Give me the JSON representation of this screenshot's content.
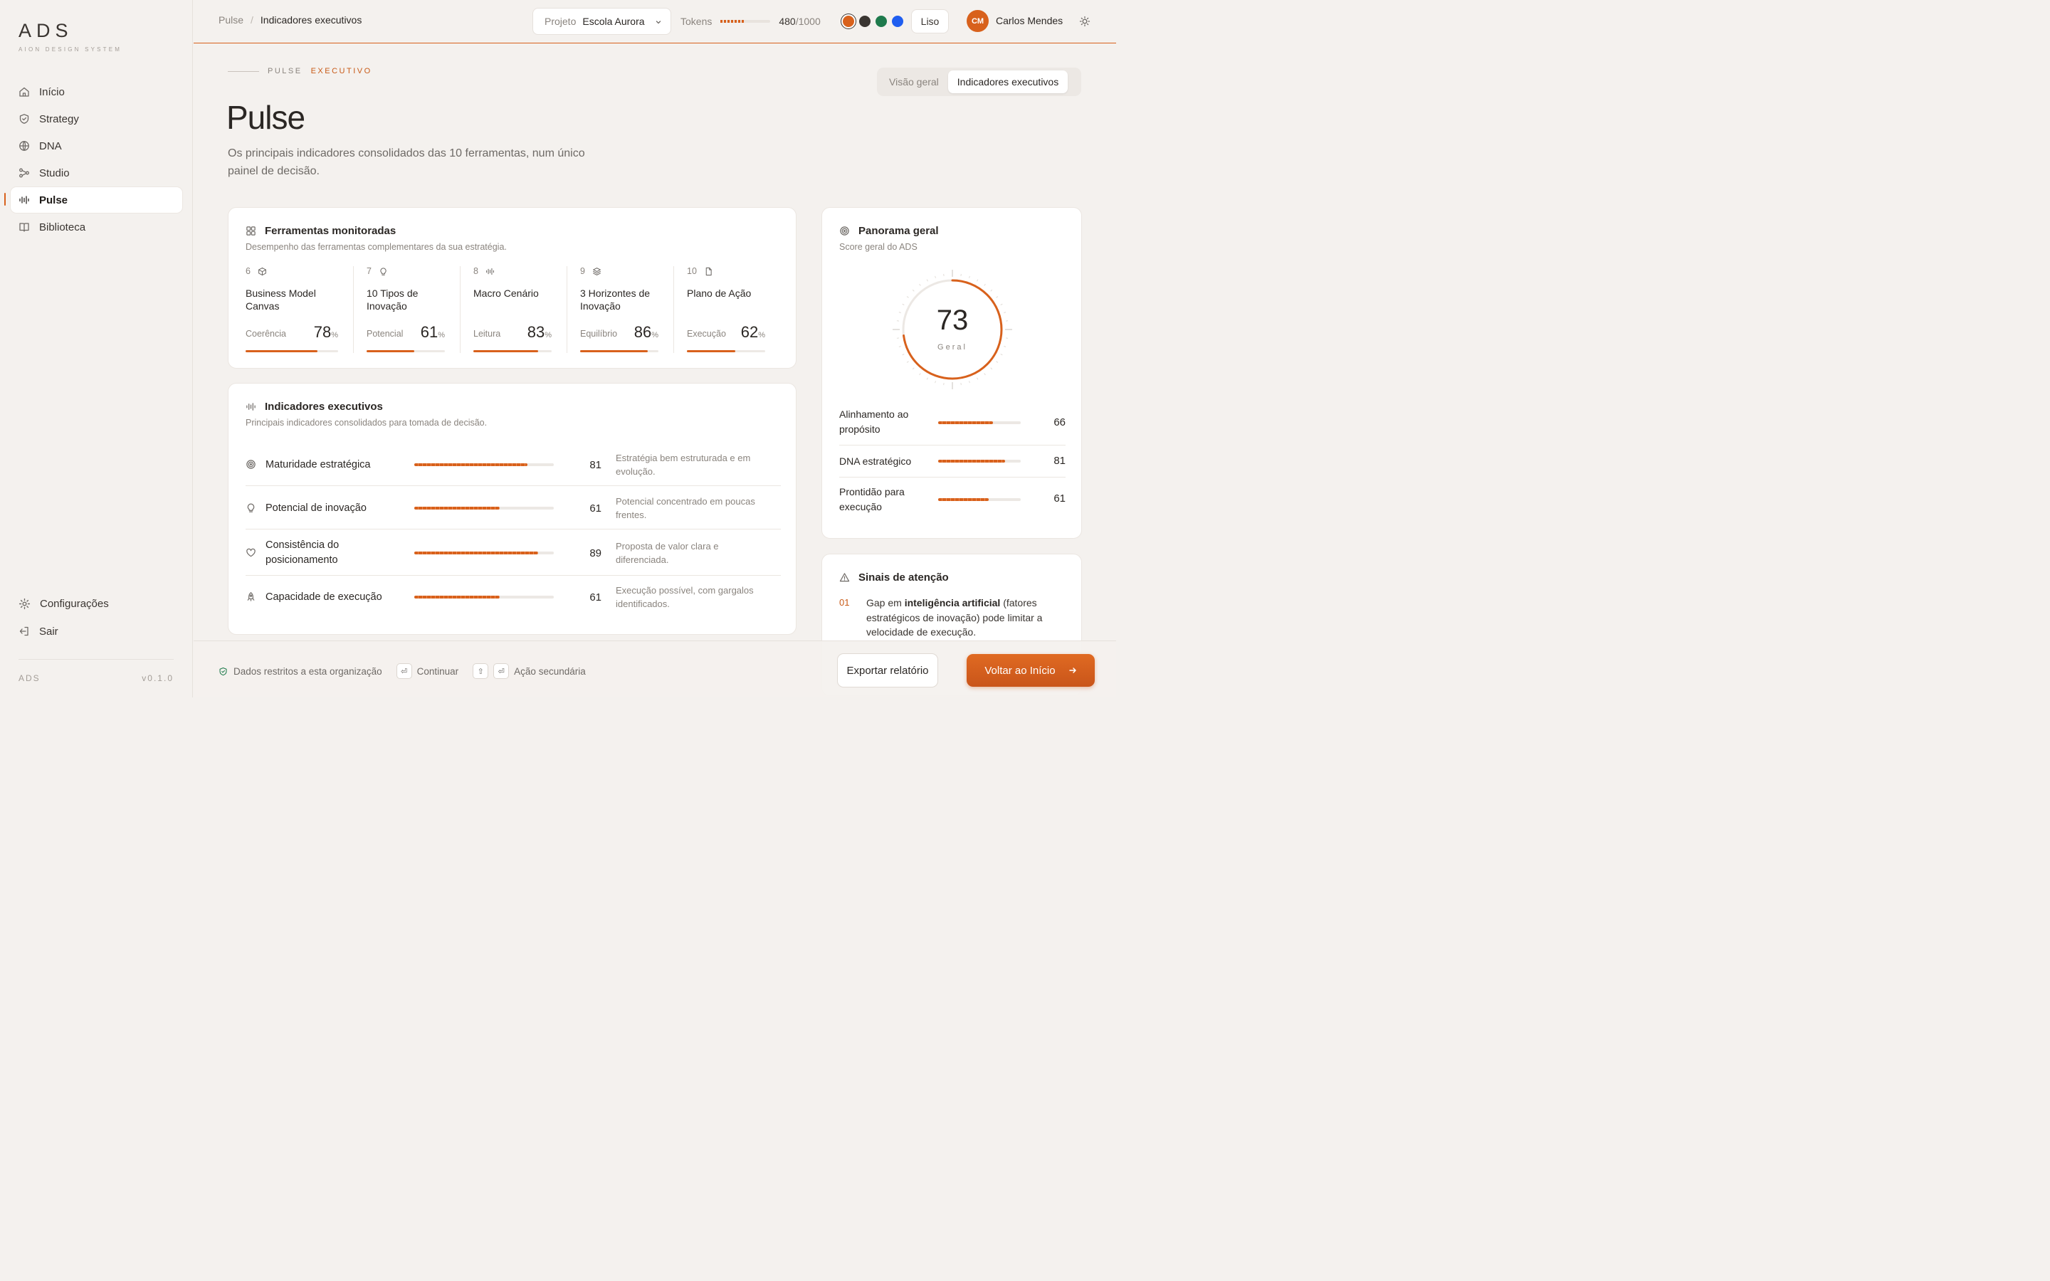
{
  "brand": {
    "logo": "ADS",
    "tagline": "AION DESIGN SYSTEM"
  },
  "sidebar": {
    "items": [
      {
        "label": "Início",
        "icon": "home-icon"
      },
      {
        "label": "Strategy",
        "icon": "shield-icon"
      },
      {
        "label": "DNA",
        "icon": "globe-icon"
      },
      {
        "label": "Studio",
        "icon": "nodes-icon"
      },
      {
        "label": "Pulse",
        "icon": "pulse-icon",
        "active": true
      },
      {
        "label": "Biblioteca",
        "icon": "book-icon"
      }
    ],
    "settings_label": "Configurações",
    "logout_label": "Sair",
    "footer_brand": "ADS",
    "version": "v0.1.0"
  },
  "header": {
    "breadcrumb": [
      "Pulse",
      "Indicadores executivos"
    ],
    "breadcrumb_sep": "/",
    "project_label": "Projeto",
    "project_value": "Escola Aurora",
    "tokens_label": "Tokens",
    "tokens_used": "480",
    "tokens_total": "/1000",
    "tokens_fraction": 0.48,
    "theme_colors": [
      "#d8611c",
      "#3a3531",
      "#1e7a4c",
      "#1f5ef0"
    ],
    "style_button": "Liso",
    "avatar_initials": "CM",
    "user_name": "Carlos Mendes"
  },
  "page": {
    "eyebrow_1": "PULSE",
    "eyebrow_2": "EXECUTIVO",
    "title": "Pulse",
    "subtitle": "Os principais indicadores consolidados das 10 ferramentas, num único painel de decisão.",
    "tabs": [
      "Visão geral",
      "Indicadores executivos"
    ],
    "active_tab": 1
  },
  "tools_card": {
    "title": "Ferramentas monitoradas",
    "subtitle": "Desempenho das ferramentas complementares da sua estratégia.",
    "tools": [
      {
        "num": "6",
        "icon": "cube-icon",
        "name": "Business Model Canvas",
        "metric": "Coerência",
        "value": "78",
        "pct": 78
      },
      {
        "num": "7",
        "icon": "bulb-icon",
        "name": "10 Tipos de Inovação",
        "metric": "Potencial",
        "value": "61",
        "pct": 61
      },
      {
        "num": "8",
        "icon": "pulse-icon",
        "name": "Macro Cenário",
        "metric": "Leitura",
        "value": "83",
        "pct": 83
      },
      {
        "num": "9",
        "icon": "layers-icon",
        "name": "3 Horizontes de Inovação",
        "metric": "Equilíbrio",
        "value": "86",
        "pct": 86
      },
      {
        "num": "10",
        "icon": "file-icon",
        "name": "Plano de Ação",
        "metric": "Execução",
        "value": "62",
        "pct": 62
      }
    ],
    "unit": "%"
  },
  "indicators_card": {
    "title": "Indicadores executivos",
    "subtitle": "Principais indicadores consolidados para tomada de decisão.",
    "rows": [
      {
        "icon": "target-icon",
        "name": "Maturidade estratégica",
        "value": "81",
        "pct": 81,
        "desc": "Estratégia bem estruturada e em evolução."
      },
      {
        "icon": "bulb-icon",
        "name": "Potencial de inovação",
        "value": "61",
        "pct": 61,
        "desc": "Potencial concentrado em poucas frentes."
      },
      {
        "icon": "heart-icon",
        "name": "Consistência do posicionamento",
        "value": "89",
        "pct": 89,
        "desc": "Proposta de valor clara e diferenciada."
      },
      {
        "icon": "rocket-icon",
        "name": "Capacidade de execução",
        "value": "61",
        "pct": 61,
        "desc": "Execução possível, com gargalos identificados."
      }
    ]
  },
  "panorama": {
    "title": "Panorama geral",
    "subtitle": "Score geral do ADS",
    "score": "73",
    "score_pct": 73,
    "score_label": "Geral",
    "rows": [
      {
        "name": "Alinhamento ao propósito",
        "value": "66",
        "pct": 66
      },
      {
        "name": "DNA estratégico",
        "value": "81",
        "pct": 81
      },
      {
        "name": "Prontidão para execução",
        "value": "61",
        "pct": 61
      }
    ]
  },
  "signals": {
    "title": "Sinais de atenção",
    "items": [
      {
        "num": "01",
        "pre": "Gap em ",
        "bold": "inteligência artificial",
        "post": " (fatores estratégicos de inovação) pode limitar a velocidade de execução."
      }
    ]
  },
  "footer": {
    "restricted": "Dados restritos a esta organização",
    "continue_key": "⏎",
    "continue_label": "Continuar",
    "secondary_key_1": "⇧",
    "secondary_key_2": "⏎",
    "secondary_label": "Ação secundária",
    "export_label": "Exportar relatório",
    "back_label": "Voltar ao Início"
  }
}
